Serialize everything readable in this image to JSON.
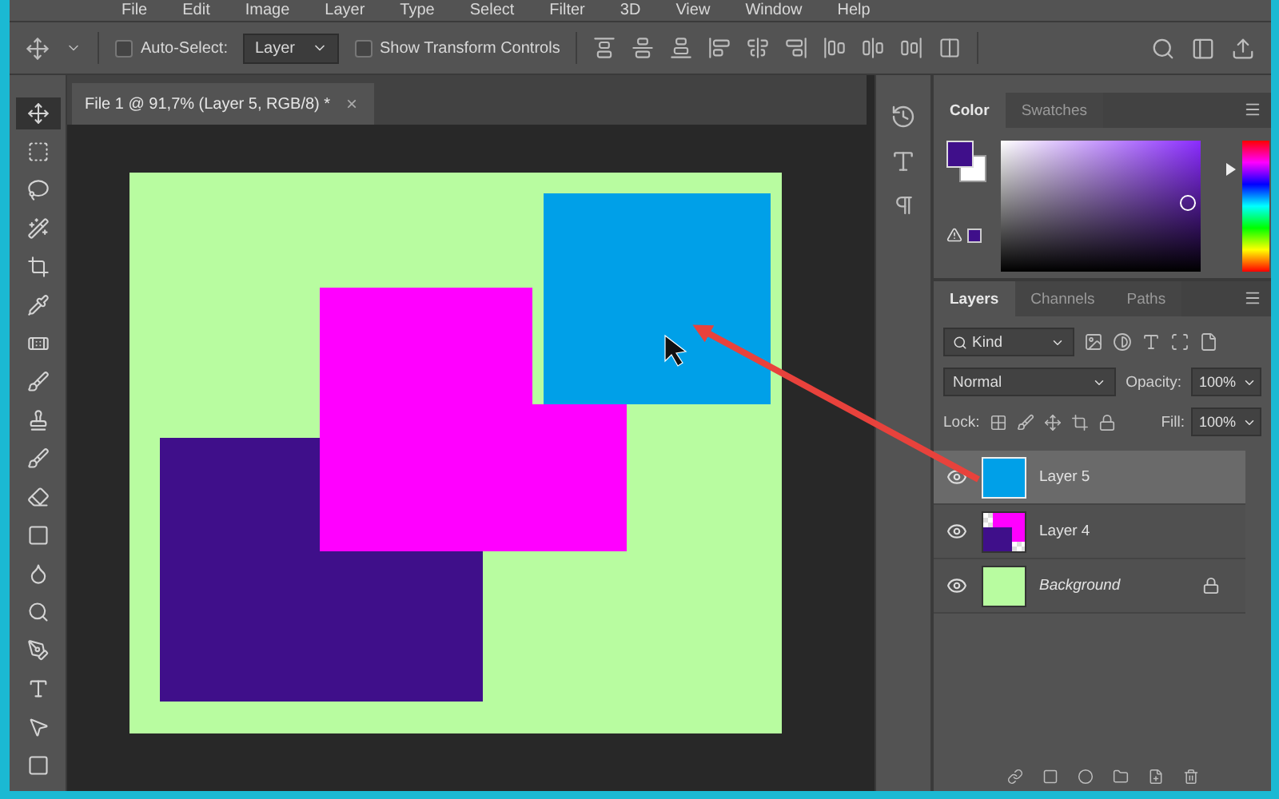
{
  "menu": [
    "File",
    "Edit",
    "Image",
    "Layer",
    "Type",
    "Select",
    "Filter",
    "3D",
    "View",
    "Window",
    "Help"
  ],
  "options_bar": {
    "auto_select": {
      "label": "Auto-Select:",
      "checked": false
    },
    "target": "Layer",
    "transform_controls": {
      "label": "Show Transform Controls",
      "checked": false
    }
  },
  "document_tab": {
    "title": "File 1 @ 91,7% (Layer 5, RGB/8) *",
    "close": "×"
  },
  "canvas_shapes": [
    {
      "kind": "rect",
      "color": "#3f0f8a"
    },
    {
      "kind": "notched",
      "color": "#ff00ff"
    },
    {
      "kind": "top",
      "color": "#00a0e8"
    }
  ],
  "color_panel": {
    "tabs": [
      {
        "label": "Color",
        "selected": true
      },
      {
        "label": "Swatches",
        "selected": false
      }
    ],
    "hue": {
      "level": 0.78
    }
  },
  "layers_panel": {
    "tabs": [
      {
        "label": "Layers",
        "selected": true
      },
      {
        "label": "Channels",
        "selected": false
      },
      {
        "label": "Paths",
        "selected": false
      }
    ],
    "filter": "Kind",
    "blend_mode": "Normal",
    "opacity_label": "Opacity:",
    "opacity": "100%",
    "lock_label": "Lock:",
    "fill_label": "Fill:",
    "fill": "100%",
    "layers": [
      {
        "name": "Layer 5",
        "kind": "layer",
        "selected": true,
        "visible": true,
        "locked": false,
        "color": "#00a0e8"
      },
      {
        "name": "Layer 4",
        "kind": "composite",
        "selected": false,
        "visible": true,
        "locked": false,
        "color": "#ff00ff"
      },
      {
        "name": "Background",
        "kind": "background",
        "selected": false,
        "visible": true,
        "locked": true,
        "color": "#b8fca0"
      }
    ]
  }
}
